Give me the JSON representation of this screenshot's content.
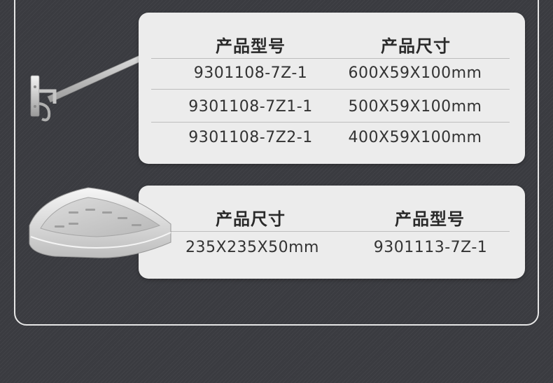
{
  "table1": {
    "headers": [
      "产品型号",
      "产品尺寸"
    ],
    "rows": [
      [
        "9301108-7Z-1",
        "600X59X100mm"
      ],
      [
        "9301108-7Z1-1",
        "500X59X100mm"
      ],
      [
        "9301108-7Z2-1",
        "400X59X100mm"
      ]
    ]
  },
  "table2": {
    "headers": [
      "产品尺寸",
      "产品型号"
    ],
    "rows": [
      [
        "235X235X50mm",
        "9301113-7Z-1"
      ]
    ]
  },
  "images": {
    "rack_icon": "towel-rack-image",
    "shelf_icon": "corner-shelf-image"
  }
}
